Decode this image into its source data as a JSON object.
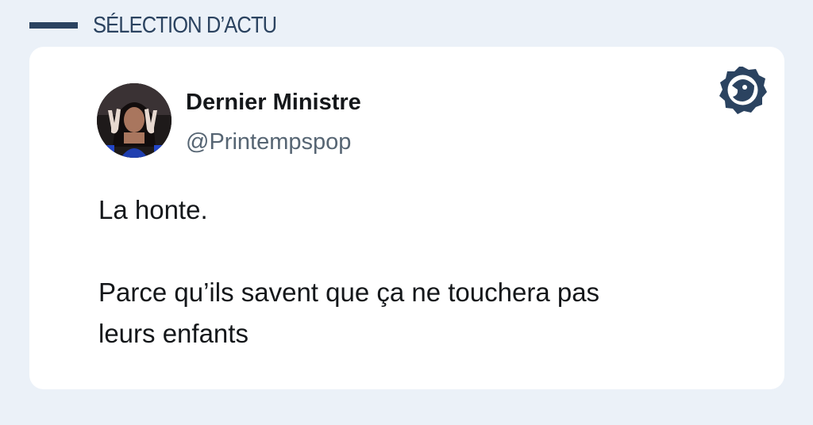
{
  "header": {
    "label": "SÉLECTION D’ACTU"
  },
  "tweet": {
    "display_name": "Dernier Ministre",
    "handle": "@Printempspop",
    "paragraph1": "La honte.",
    "paragraph2_line1": "Parce qu’ils savent que ça ne touchera pas",
    "paragraph2_line2": "leurs enfants"
  },
  "icons": {
    "badge": "brand-logo-icon",
    "avatar": "avatar-photo"
  },
  "colors": {
    "accent": "#2b4360",
    "background": "#ebf1f8",
    "card": "#ffffff"
  }
}
